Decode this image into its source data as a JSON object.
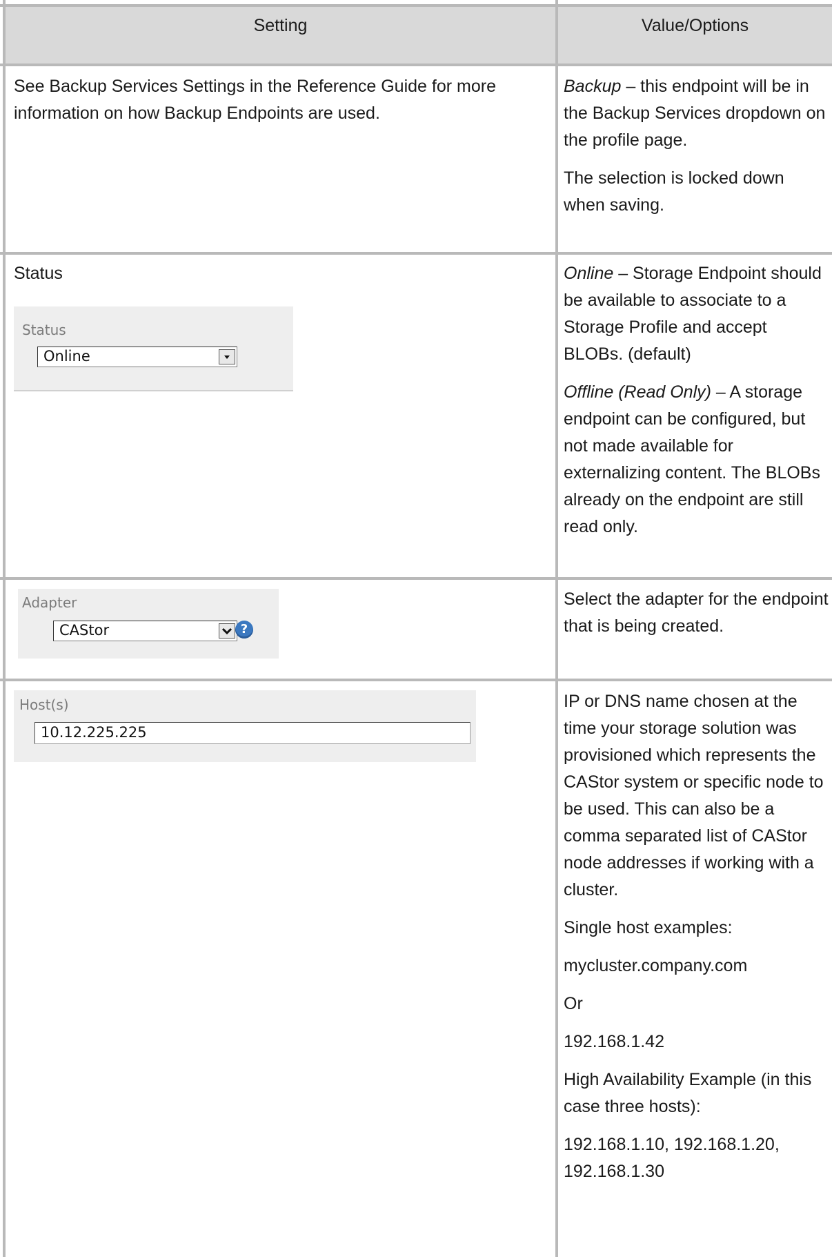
{
  "table": {
    "headers": [
      "Setting",
      "Value/Options"
    ],
    "rows": [
      {
        "setting": "See Backup Services Settings in the Reference Guide for more information on how Backup Endpoints are used.",
        "value_term": "Backup",
        "value_text": " – this endpoint will be in the Backup Services dropdown on the profile page.",
        "value_para2": "The selection is locked down when saving."
      },
      {
        "setting": "Status",
        "ui": {
          "label": "Status",
          "selected": "Online"
        },
        "value_term": "Online",
        "value_text": " – Storage Endpoint should be available to associate to a Storage Profile and accept BLOBs. (default)",
        "value_term2": "Offline (Read Only)",
        "value_text2": " – A storage endpoint can be configured, but not made available for externalizing content. The BLOBs already on the endpoint are still read only."
      },
      {
        "ui": {
          "label": "Adapter",
          "selected": "CAStor",
          "help": "?"
        },
        "value_text": "Select the adapter for the endpoint that is being created."
      },
      {
        "ui": {
          "label": "Host(s)",
          "value": "10.12.225.225"
        },
        "value_paras": [
          "IP or DNS name chosen at the time your storage solution was provisioned which represents the CAStor system or specific node to be used.  This can also be a comma separated list of CAStor node addresses if working with a cluster.",
          "Single host examples:",
          "mycluster.company.com",
          "Or",
          "192.168.1.42",
          "High Availability Example (in this case three hosts):",
          "192.168.1.10, 192.168.1.20, 192.168.1.30"
        ]
      }
    ]
  }
}
